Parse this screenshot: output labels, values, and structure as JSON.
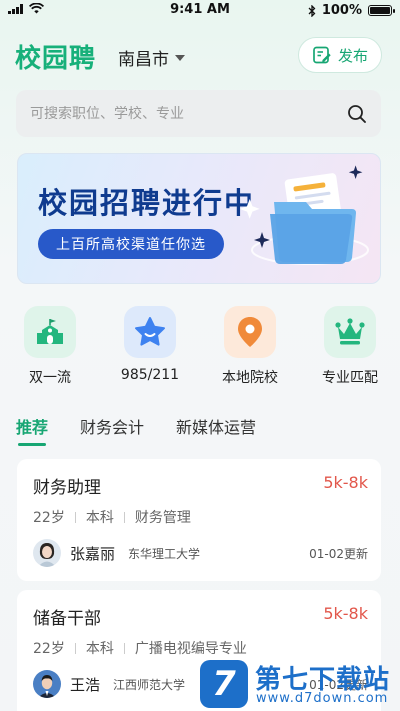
{
  "status_bar": {
    "time": "9:41 AM",
    "battery": "100%",
    "battery_level": 1.0
  },
  "header": {
    "logo": "校园聘",
    "city": "南昌市",
    "publish_label": "发布"
  },
  "search": {
    "placeholder": "可搜索职位、学校、专业"
  },
  "banner": {
    "title": "校园招聘进行中",
    "subtitle": "上百所高校渠道任你选"
  },
  "categories": [
    {
      "label": "双一流",
      "icon": "school-building-icon",
      "color": "#23b67e"
    },
    {
      "label": "985/211",
      "icon": "star-icon",
      "color": "#3e82f0"
    },
    {
      "label": "本地院校",
      "icon": "location-pin-icon",
      "color": "#f08a3a"
    },
    {
      "label": "专业匹配",
      "icon": "crown-icon",
      "color": "#23b67e"
    }
  ],
  "tabs": [
    {
      "label": "推荐",
      "active": true
    },
    {
      "label": "财务会计",
      "active": false
    },
    {
      "label": "新媒体运营",
      "active": false
    }
  ],
  "jobs": [
    {
      "title": "财务助理",
      "salary": "5k-8k",
      "tags": [
        "22岁",
        "本科",
        "财务管理"
      ],
      "hr_name": "张嘉丽",
      "school": "东华理工大学",
      "updated": "01-02更新"
    },
    {
      "title": "储备干部",
      "salary": "5k-8k",
      "tags": [
        "22岁",
        "本科",
        "广播电视编导专业"
      ],
      "hr_name": "王浩",
      "school": "江西师范大学",
      "updated": "01-02更新"
    }
  ],
  "watermark": {
    "mark": "7",
    "title": "第七下载站",
    "url": "www.d7down.com"
  },
  "colors": {
    "brand": "#17a673",
    "salary": "#e2574b",
    "banner_button": "#2859c9"
  }
}
